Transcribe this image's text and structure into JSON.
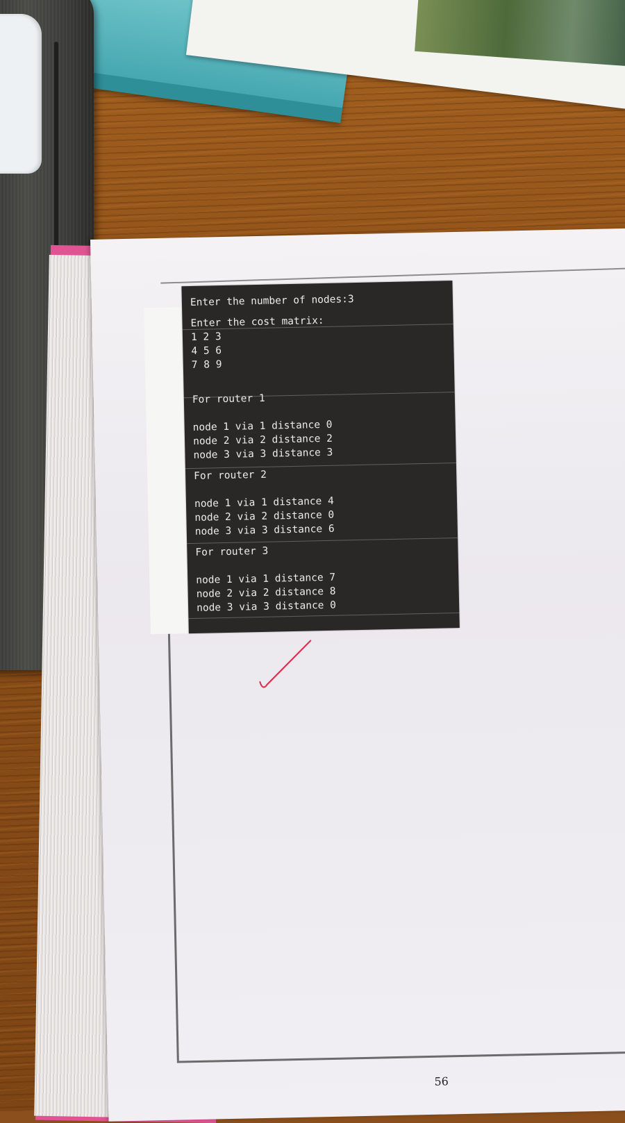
{
  "terminal": {
    "prompt_nodes": "Enter the number of nodes:3",
    "prompt_matrix": "Enter the cost matrix:",
    "matrix_rows": [
      "1 2 3",
      "4 5 6",
      "7 8 9"
    ],
    "routers": [
      {
        "title": "For router 1",
        "lines": [
          "node 1 via 1 distance 0",
          "node 2 via 2 distance 2",
          "node 3 via 3 distance 3"
        ]
      },
      {
        "title": "For router 2",
        "lines": [
          "node 1 via 1 distance 4",
          "node 2 via 2 distance 0",
          "node 3 via 3 distance 6"
        ]
      },
      {
        "title": "For router 3",
        "lines": [
          "node 1 via 1 distance 7",
          "node 2 via 2 distance 8",
          "node 3 via 3 distance 0"
        ]
      }
    ]
  },
  "page_number": "56",
  "colors": {
    "terminal_bg": "#2a2727",
    "terminal_text": "#ececec",
    "check_ink": "#d8344f",
    "cover": "#e05493",
    "desk": "#8d4f18"
  }
}
